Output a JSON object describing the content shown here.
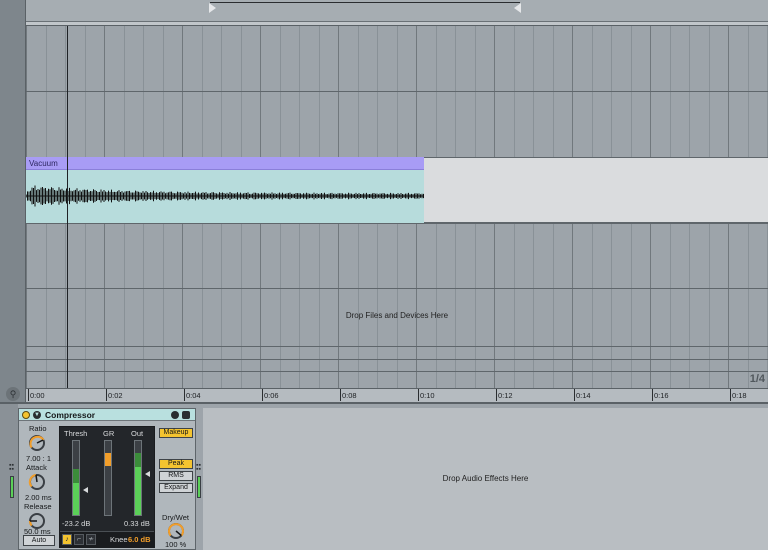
{
  "arrangement": {
    "clip_name": "Vacuum",
    "drop_files_text": "Drop Files and Devices Here",
    "page_indicator": "1/4",
    "timeline_ticks": [
      "0:00",
      "0:02",
      "0:04",
      "0:06",
      "0:08",
      "0:10",
      "0:12",
      "0:14",
      "0:16",
      "0:18"
    ]
  },
  "compressor": {
    "title": "Compressor",
    "ratio_label": "Ratio",
    "ratio_value": "7.00 : 1",
    "attack_label": "Attack",
    "attack_value": "2.00 ms",
    "release_label": "Release",
    "release_value": "50.0 ms",
    "auto_label": "Auto",
    "thresh_label": "Thresh",
    "gr_label": "GR",
    "out_label": "Out",
    "thresh_value": "-23.2 dB",
    "out_value": "0.33 dB",
    "knee_label": "Knee",
    "knee_value": "6.0 dB",
    "makeup_label": "Makeup",
    "peak_label": "Peak",
    "rms_label": "RMS",
    "expand_label": "Expand",
    "drywet_label": "Dry/Wet",
    "drywet_value": "100 %"
  },
  "device_chain": {
    "drop_effects_text": "Drop Audio Effects Here"
  },
  "colors": {
    "clip_header": "#a89cf5",
    "clip_body": "#b7dcdc",
    "meter_green": "#5bd058",
    "gr_orange": "#f29e2a",
    "active_yellow": "#f4c430"
  }
}
